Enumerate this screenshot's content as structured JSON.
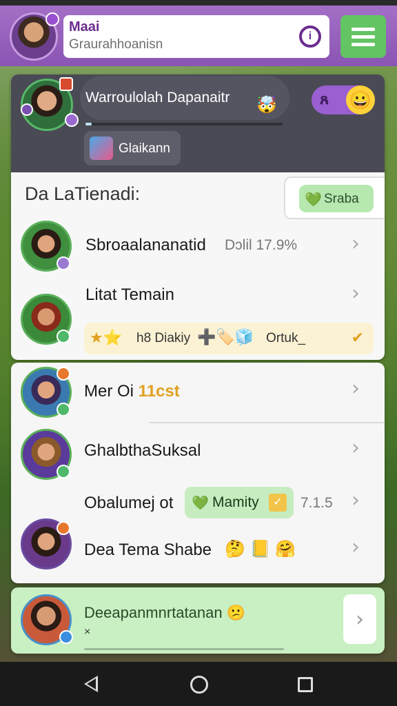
{
  "header": {
    "title": "Maai",
    "subtitle": "Graurahhoanisn",
    "info_icon": "info-icon",
    "menu_icon": "hamburger-menu-icon"
  },
  "profile": {
    "name": "Warroulolah Dapanaitr",
    "name_emoji": "🤯",
    "progress": 0.03,
    "action_label": "Glaikann",
    "toggle_icon": "person-icon",
    "toggle_emoji": "😀"
  },
  "section": {
    "title": "Da LaTienadi:",
    "filter_label": "Sraba",
    "filter_icon": "💚"
  },
  "rows": [
    {
      "name": "Sbroaalananatid",
      "meta": "Dɔlil  17.9%"
    },
    {
      "name": "Litat Temain"
    },
    {
      "name": "Mer Oi",
      "highlight": "11cst"
    },
    {
      "name": "GhalbthaSuksal"
    },
    {
      "name": "Obalumej ot",
      "pill_label": "Mamity",
      "meta": "7.1.5"
    },
    {
      "name": "Dea Tema Shabe",
      "emojis": "🤔 📒 🤗"
    }
  ],
  "reward": {
    "stars": "★⭐",
    "text1": "h8 Diakiy",
    "icons": "➕🏷️🧊",
    "text2": "Ortuk_",
    "check": "✔"
  },
  "footer_card": {
    "title": "Deeapanmnrtatanan",
    "title_emoji": "😕",
    "subtitle": "×"
  },
  "colors": {
    "header_purple": "#8a55b3",
    "accent_green": "#62c462",
    "panel_dark": "#4a4a55",
    "highlight_yellow": "#e0a020"
  }
}
